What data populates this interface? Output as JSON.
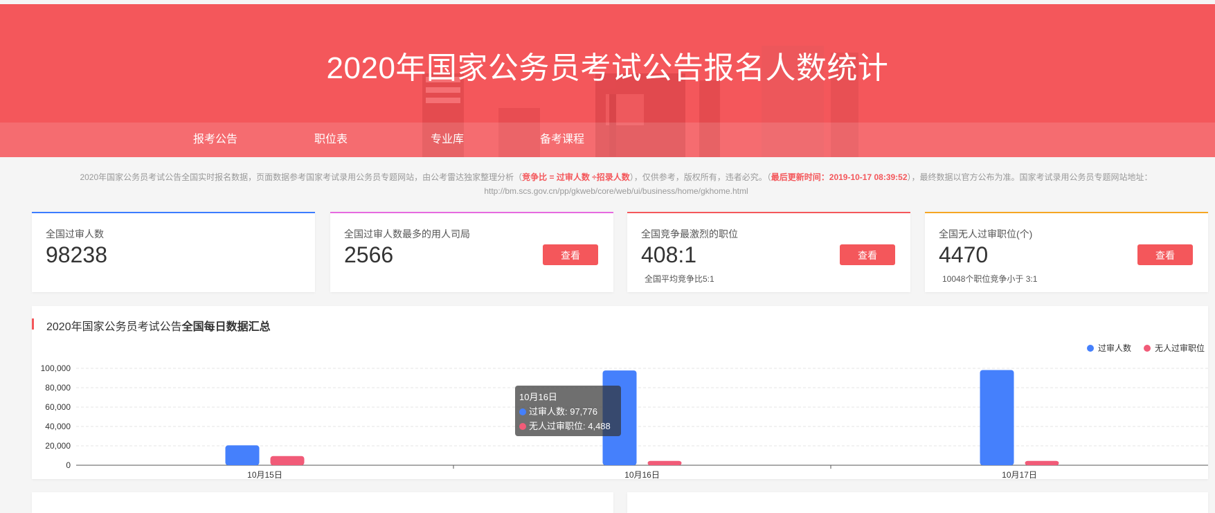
{
  "page": {
    "title": "2020年国家公务员考试公告报名人数统计",
    "nav": [
      "报考公告",
      "职位表",
      "专业库",
      "备考课程"
    ]
  },
  "notice": {
    "part1": "2020年国家公务员考试公告全国实时报名数据，页面数据参考国家考试录用公务员专题网站，由公考雷达独家整理分析（",
    "formula": "竞争比 = 过审人数 ÷招录人数",
    "part2": "），仅供参考，版权所有，违者必究。（",
    "updated": "最后更新时间：2019-10-17 08:39:52",
    "part3": "），最终数据以官方公布为准。国家考试录用公务员专题网站地址：",
    "url": "http://bm.scs.gov.cn/pp/gkweb/core/web/ui/business/home/gkhome.html"
  },
  "cards": [
    {
      "label": "全国过审人数",
      "value": "98238",
      "accent": "#3b7cff"
    },
    {
      "label": "全国过审人数最多的用人司局",
      "value": "2566",
      "button": "查看",
      "accent": "#e66ae0"
    },
    {
      "label": "全国竞争最激烈的职位",
      "value": "408:1",
      "button": "查看",
      "sub": "全国平均竞争比5:1",
      "accent": "#f4575b"
    },
    {
      "label": "全国无人过审职位(个)",
      "value": "4470",
      "button": "查看",
      "sub": "10048个职位竞争小于 3:1",
      "accent": "#f5a623"
    }
  ],
  "chart": {
    "title_prefix": "2020年国家公务员考试公告",
    "title_bold": "全国每日数据汇总"
  },
  "tooltip": {
    "title": "10月16日",
    "line1": "过审人数: 97,776",
    "line2": "无人过审职位: 4,488"
  },
  "colors": {
    "primary": "#f4575b",
    "blue": "#4580fc",
    "pink": "#f15b78"
  },
  "chart_data": {
    "type": "bar",
    "categories": [
      "10月15日",
      "10月16日",
      "10月17日"
    ],
    "series": [
      {
        "name": "过审人数",
        "values": [
          20500,
          97776,
          98238
        ],
        "color": "#4580fc"
      },
      {
        "name": "无人过审职位",
        "values": [
          9500,
          4488,
          4470
        ],
        "color": "#f15b78"
      }
    ],
    "yticks": [
      "0",
      "20,000",
      "40,000",
      "60,000",
      "80,000",
      "100,000"
    ],
    "ylim": [
      0,
      100000
    ],
    "legend": "top-right",
    "grid": true
  }
}
